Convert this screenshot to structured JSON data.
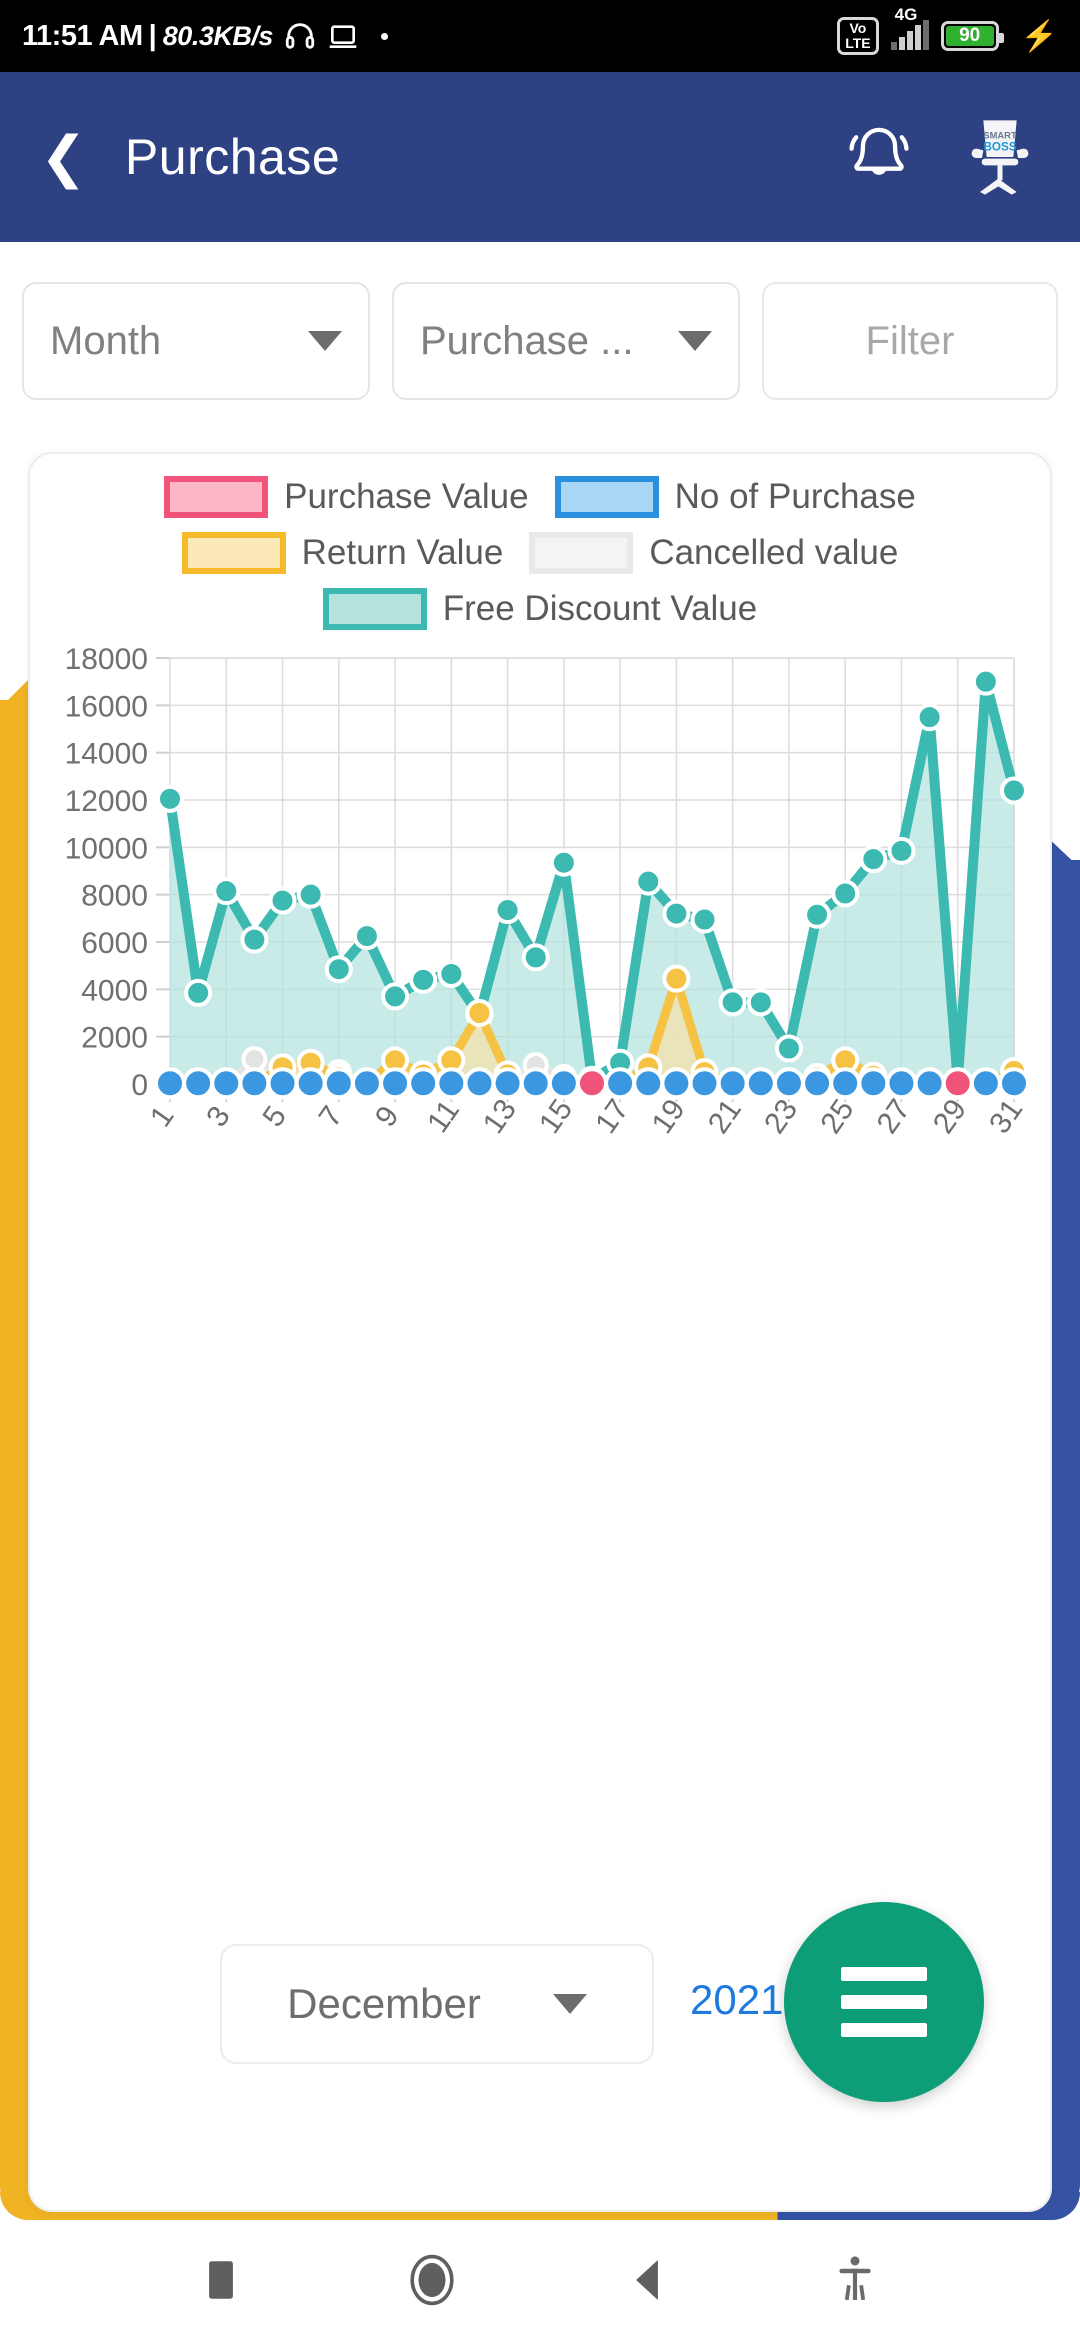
{
  "statusbar": {
    "time": "11:51 AM",
    "separator": "|",
    "network_speed": "80.3KB/s",
    "headphone_icon": "headphone-icon",
    "cast_icon": "cast-icon",
    "volte_top": "Vo",
    "volte_bottom": "LTE",
    "network_type": "4G",
    "battery_percent": "90",
    "charging_icon": "lightning-bolt-icon"
  },
  "appbar": {
    "back_icon": "back-chevron-icon",
    "title": "Purchase",
    "bell_icon": "notification-bell-icon",
    "logo_icon": "smart-boss-chair-logo",
    "logo_text_top": "SMART",
    "logo_text_bottom": "BOSS",
    "background_color": "#2e4283"
  },
  "filters": {
    "month_dropdown": "Month",
    "type_dropdown": "Purchase ...",
    "filter_button": "Filter"
  },
  "footer": {
    "month_value": "December",
    "year_value": "2021",
    "menu_fab": "hamburger-menu-fab"
  },
  "navbar": {
    "recent_apps": "recent-apps-icon",
    "home": "home-icon",
    "back": "back-icon",
    "accessibility": "accessibility-icon"
  },
  "chart_data": {
    "type": "area",
    "title": "",
    "xlabel": "",
    "ylabel": "",
    "ylim": [
      0,
      18000
    ],
    "grid": true,
    "legend_position": "top",
    "ytick_labels": [
      "18000",
      "16000",
      "14000",
      "12000",
      "10000",
      "8000",
      "6000",
      "4000",
      "2000",
      "0"
    ],
    "yticks": [
      18000,
      16000,
      14000,
      12000,
      10000,
      8000,
      6000,
      4000,
      2000,
      0
    ],
    "categories": [
      1,
      2,
      3,
      4,
      5,
      6,
      7,
      8,
      9,
      10,
      11,
      12,
      13,
      14,
      15,
      16,
      17,
      18,
      19,
      20,
      21,
      22,
      23,
      24,
      25,
      26,
      27,
      28,
      29,
      30,
      31
    ],
    "xtick_labels": [
      "1",
      "3",
      "5",
      "7",
      "9",
      "11",
      "13",
      "15",
      "17",
      "19",
      "21",
      "23",
      "25",
      "27",
      "29",
      "31"
    ],
    "series": [
      {
        "name": "Free Discount Value",
        "color": "#3cb9b0",
        "fill": "#b4e3de",
        "legend_fill": "#b4e3de",
        "legend_border": "#3cb9b0",
        "values": [
          12050,
          3850,
          8150,
          6100,
          7750,
          8000,
          4850,
          6250,
          3700,
          4400,
          4650,
          2900,
          7350,
          5350,
          9350,
          180,
          900,
          8550,
          7200,
          6950,
          3450,
          3450,
          1500,
          7150,
          8050,
          9500,
          9850,
          15500,
          120,
          17000,
          12400
        ]
      },
      {
        "name": "Return Value",
        "color": "#f5c243",
        "fill": "#f2e2b0",
        "legend_fill": "#fde9b8",
        "legend_border": "#f5bb2a",
        "values": [
          0,
          0,
          0,
          0,
          700,
          900,
          300,
          0,
          1000,
          400,
          1000,
          3000,
          400,
          0,
          0,
          0,
          0,
          700,
          4450,
          500,
          0,
          0,
          0,
          300,
          1000,
          350,
          0,
          0,
          0,
          0,
          550
        ]
      },
      {
        "name": "Cancelled value",
        "color": "#e3e3e3",
        "fill": "#ededed",
        "legend_fill": "#f4f4f4",
        "legend_border": "#e6e6e6",
        "values": [
          0,
          0,
          0,
          1050,
          500,
          600,
          500,
          0,
          0,
          0,
          0,
          0,
          0,
          800,
          300,
          0,
          0,
          0,
          0,
          0,
          0,
          0,
          0,
          0,
          0,
          200,
          0,
          0,
          0,
          0,
          0
        ]
      },
      {
        "name": "No of Purchase",
        "color": "#3b97e0",
        "fill": "#a9d6f5",
        "legend_fill": "#a9d6f5",
        "legend_border": "#2a8fdd",
        "values": [
          30,
          30,
          30,
          30,
          30,
          30,
          30,
          30,
          30,
          30,
          30,
          30,
          30,
          30,
          30,
          30,
          30,
          30,
          30,
          30,
          30,
          30,
          30,
          30,
          30,
          30,
          30,
          30,
          30,
          30,
          30
        ]
      },
      {
        "name": "Purchase Value",
        "color": "#f1547b",
        "fill": "#fbb7c6",
        "legend_fill": "#fbb7c6",
        "legend_border": "#f1547b",
        "values": [
          0,
          0,
          0,
          0,
          0,
          0,
          0,
          0,
          0,
          0,
          0,
          0,
          0,
          0,
          0,
          30,
          0,
          0,
          0,
          0,
          0,
          0,
          0,
          0,
          0,
          0,
          0,
          0,
          30,
          0,
          0
        ]
      }
    ],
    "legend_rows": [
      [
        {
          "label": "Purchase Value",
          "fill": "#fbb7c6",
          "border": "#f1547b"
        },
        {
          "label": "No of Purchase",
          "fill": "#a9d6f5",
          "border": "#2a8fdd"
        }
      ],
      [
        {
          "label": "Return Value",
          "fill": "#fde9b8",
          "border": "#f5bb2a"
        },
        {
          "label": "Cancelled value",
          "fill": "#f4f4f4",
          "border": "#e9e9e9"
        }
      ],
      [
        {
          "label": "Free Discount Value",
          "fill": "#b4e3de",
          "border": "#3cb9b0"
        }
      ]
    ]
  }
}
